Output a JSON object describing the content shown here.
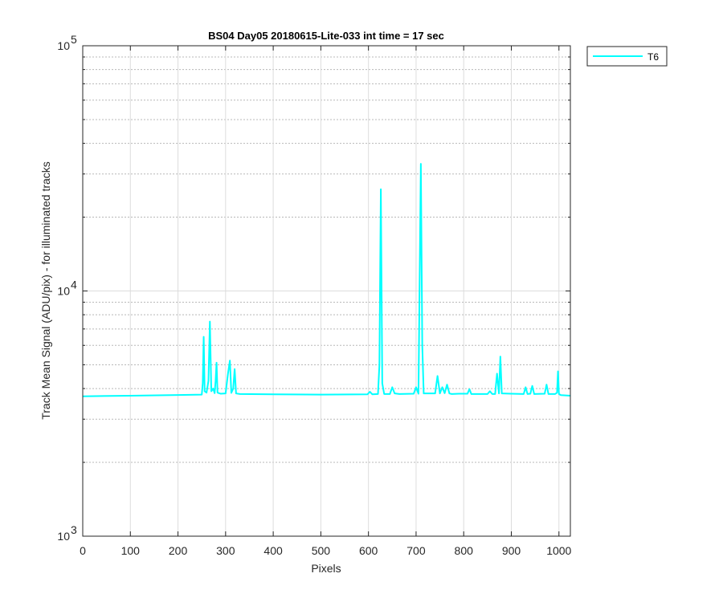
{
  "chart_data": {
    "type": "line",
    "title": "BS04 Day05 20180615-Lite-033 int time = 17 sec",
    "xlabel": "Pixels",
    "ylabel": "Track Mean Signal (ADU/pix) - for illuminated tracks",
    "xlim": [
      0,
      1024
    ],
    "ylim": [
      1000,
      100000
    ],
    "yscale": "log",
    "xticks": [
      0,
      100,
      200,
      300,
      400,
      500,
      600,
      700,
      800,
      900,
      1000
    ],
    "xtick_labels": [
      "0",
      "100",
      "200",
      "300",
      "400",
      "500",
      "600",
      "700",
      "800",
      "900",
      "1000"
    ],
    "yticks": [
      {
        "value": 1000,
        "base": "10",
        "exp": "3"
      },
      {
        "value": 10000,
        "base": "10",
        "exp": "4"
      },
      {
        "value": 100000,
        "base": "10",
        "exp": "5"
      }
    ],
    "grid": true,
    "legend_placement": "outside-top-right",
    "series": [
      {
        "name": "T6",
        "color": "#00ffff",
        "x": [
          0,
          100,
          200,
          250,
          252,
          254,
          256,
          260,
          264,
          267,
          270,
          274,
          277,
          279,
          281,
          283,
          286,
          290,
          300,
          305,
          309,
          312,
          316,
          319,
          322,
          330,
          400,
          500,
          598,
          603,
          608,
          620,
          623,
          626,
          629,
          633,
          645,
          650,
          655,
          665,
          695,
          700,
          705,
          707,
          710,
          713,
          716,
          740,
          745,
          750,
          755,
          760,
          765,
          770,
          775,
          790,
          808,
          812,
          816,
          850,
          855,
          860,
          866,
          870,
          874,
          877,
          880,
          900,
          926,
          930,
          934,
          940,
          944,
          948,
          970,
          974,
          978,
          992,
          996,
          998,
          1000,
          1004,
          1024
        ],
        "y": [
          3720,
          3740,
          3765,
          3780,
          4200,
          6500,
          3900,
          3850,
          4300,
          7500,
          3900,
          4000,
          3830,
          4300,
          5100,
          3850,
          3830,
          3810,
          3820,
          4600,
          5200,
          3840,
          4000,
          4800,
          3820,
          3800,
          3790,
          3780,
          3790,
          3880,
          3790,
          3800,
          5000,
          26000,
          4200,
          3800,
          3800,
          4050,
          3820,
          3800,
          3810,
          4050,
          3810,
          9000,
          33000,
          6000,
          3820,
          3820,
          4500,
          3820,
          4050,
          3830,
          4150,
          3820,
          3800,
          3810,
          3810,
          3980,
          3800,
          3800,
          3900,
          3800,
          3800,
          4600,
          3820,
          5400,
          3820,
          3810,
          3800,
          4050,
          3800,
          3810,
          4100,
          3800,
          3810,
          4150,
          3800,
          3800,
          3850,
          4700,
          3800,
          3760,
          3740
        ]
      }
    ]
  }
}
